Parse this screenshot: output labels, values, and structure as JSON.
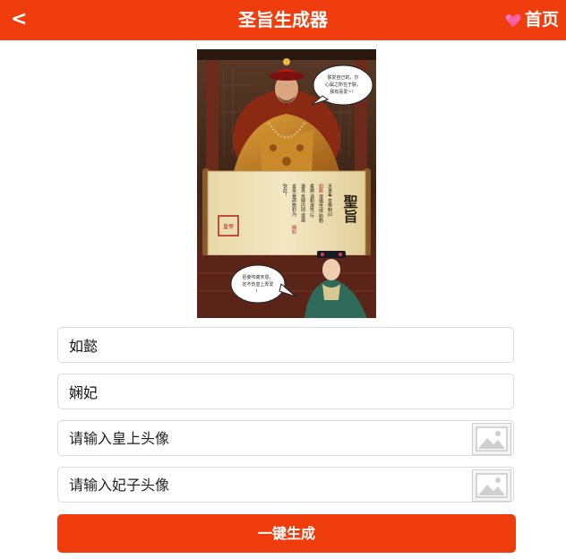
{
  "header": {
    "back_label": "<",
    "title": "圣旨生成器",
    "home_label": "首页"
  },
  "preview": {
    "emperor_bubble": "朕爱自己的，尔心属之所在于朕，朕有喜爱~！",
    "scroll_title": "聖旨",
    "scroll_side": "天承奉 皇帝制曰",
    "consort_bubble": "臣妾叩谢天恩，定不负皇上厚爱！",
    "seal_text": "皇帝之宝"
  },
  "form": {
    "emperor_name": "如懿",
    "consort_name": "娴妃",
    "emperor_avatar_placeholder": "请输入皇上头像",
    "consort_avatar_placeholder": "请输入妃子头像",
    "generate_label": "一键生成"
  },
  "colors": {
    "brand": "#f03d0e"
  }
}
